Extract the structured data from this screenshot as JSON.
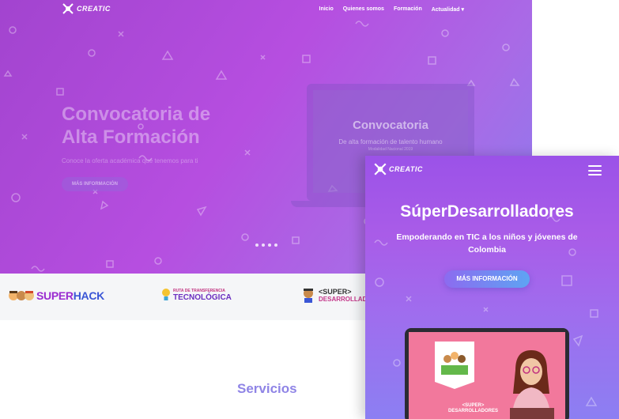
{
  "desktop": {
    "brand": "CREATIC",
    "nav": [
      "Inicio",
      "Quienes somos",
      "Formación",
      "Actualidad"
    ],
    "hero": {
      "title_line1": "Convocatoria de",
      "title_line2": "Alta Formación",
      "text": "Conoce la oferta académica que tenemos para ti",
      "button": "MÁS INFORMACIÓN"
    },
    "laptop": {
      "title": "Convocatoria",
      "subtitle": "De alta formación de talento humano",
      "small": "Modalidad Nacional 2019"
    },
    "logos": {
      "superhack_a": "SUPER",
      "superhack_b": "HACK",
      "ruta_small": "RUTA DE TRANSFERENCIA",
      "ruta_big": "TECNOLÓGICA",
      "super_a": "<SUPER>",
      "super_b": "DESARROLLADORES"
    },
    "section_title": "Servicios"
  },
  "mobile": {
    "brand": "CREATIC",
    "title": "SúperDesarrolladores",
    "subtitle": "Empoderando en TIC a los niños y jóvenes de Colombia",
    "button": "MÁS INFORMACIÓN",
    "screen_logo_a": "<SUPER>",
    "screen_logo_b": "DESARROLLADORES"
  },
  "colors": {
    "hero_start": "#a244cf",
    "hero_end": "#8b7dee",
    "section_title": "#8f84e6",
    "button_start": "#8c6bf0",
    "button_end": "#5ea4f3"
  },
  "icons": [
    "creatic-logo-icon",
    "chevron-down-icon",
    "hamburger-menu-icon",
    "lightbulb-icon"
  ]
}
